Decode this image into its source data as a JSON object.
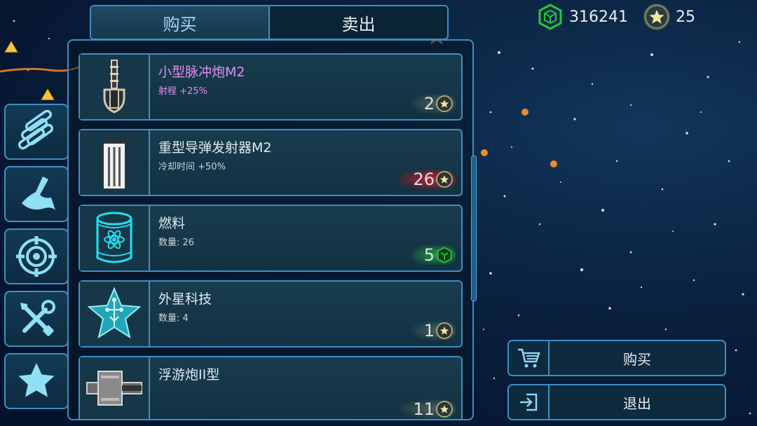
{
  "tabs": {
    "buy": "购买",
    "sell": "卖出"
  },
  "currency": {
    "gems": "316241",
    "stars": "25"
  },
  "categories": [
    {
      "icon": "ammo-icon"
    },
    {
      "icon": "hull-icon"
    },
    {
      "icon": "target-icon"
    },
    {
      "icon": "tools-icon"
    },
    {
      "icon": "star-icon"
    }
  ],
  "items": [
    {
      "name": "小型脉冲炮M2",
      "sub": "射程 +25%",
      "price": "2",
      "currency": "star",
      "name_color": "#e48cf0"
    },
    {
      "name": "重型导弹发射器M2",
      "sub": "冷却时间 +50%",
      "price": "26",
      "currency": "star",
      "glow": "red"
    },
    {
      "name": "燃料",
      "sub": "数量: 26",
      "price": "5",
      "currency": "gem",
      "glow": "green"
    },
    {
      "name": "外星科技",
      "sub": "数量: 4",
      "price": "1",
      "currency": "star"
    },
    {
      "name": "浮游炮II型",
      "sub": "",
      "price": "11",
      "currency": "star"
    }
  ],
  "actions": {
    "buy": "购买",
    "exit": "退出"
  },
  "colors": {
    "accent": "#3b8fc4",
    "gem": "#22c83a",
    "star": "#f1e7a0",
    "purple": "#e48cf0"
  }
}
